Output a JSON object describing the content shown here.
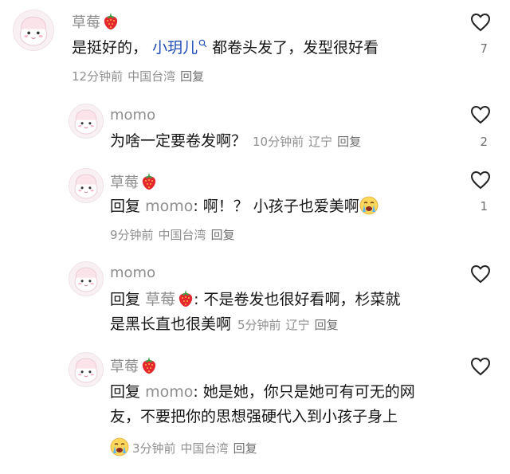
{
  "comments": [
    {
      "name": "草莓",
      "text_before": "是挺好的，",
      "mention": "小玥儿",
      "text_after": " 都卷头发了，发型很好看",
      "time": "12分钟前",
      "location": "中国台湾",
      "reply": "回复",
      "likes": "7"
    },
    {
      "name": "momo",
      "text": "为啥一定要卷发啊？",
      "time": "10分钟前",
      "location": "辽宁",
      "reply": "回复",
      "likes": "2"
    },
    {
      "name": "草莓",
      "reply_prefix": "回复",
      "reply_to": "momo",
      "text": ": 啊！？ 小孩子也爱美啊",
      "time": "9分钟前",
      "location": "中国台湾",
      "reply": "回复",
      "likes": "1"
    },
    {
      "name": "momo",
      "reply_prefix": "回复",
      "reply_to": "草莓",
      "text_line1": ": 不是卷发也很好看啊，杉菜就",
      "text_line2": "是黑长直也很美啊",
      "time": "5分钟前",
      "location": "辽宁",
      "reply": "回复",
      "likes": ""
    },
    {
      "name": "草莓",
      "reply_prefix": "回复",
      "reply_to": "momo",
      "text_line1": ": 她是她，你只是她可有可无的网",
      "text_line2": "友，不要把你的思想强硬代入到小孩子身上",
      "time": "3分钟前",
      "location": "中国台湾",
      "reply": "回复",
      "likes": ""
    }
  ]
}
